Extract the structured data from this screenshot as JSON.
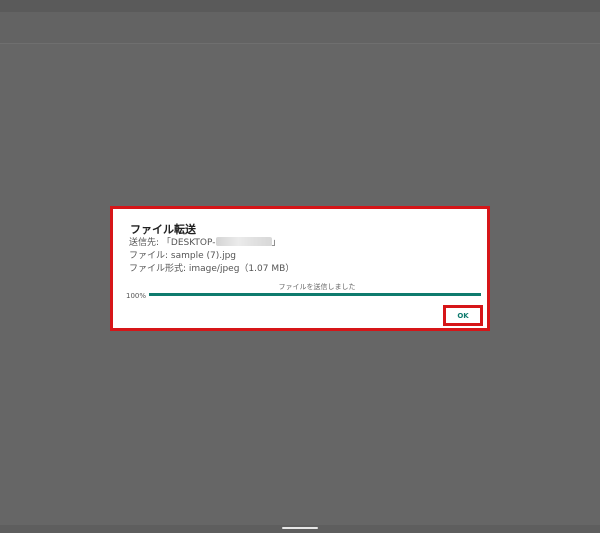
{
  "dialog": {
    "title": "ファイル転送",
    "destination_prefix": "送信先: 「DESKTOP-",
    "destination_suffix": "」",
    "file_line": "ファイル: sample (7).jpg",
    "type_line": "ファイル形式: image/jpeg（1.07 MB）",
    "status_text": "ファイルを送信しました",
    "progress_label": "100%",
    "progress_value": 1.0,
    "ok_label": "OK"
  },
  "colors": {
    "accent": "#0f7b6e",
    "highlight": "#d61518",
    "backdrop": "#666666"
  }
}
